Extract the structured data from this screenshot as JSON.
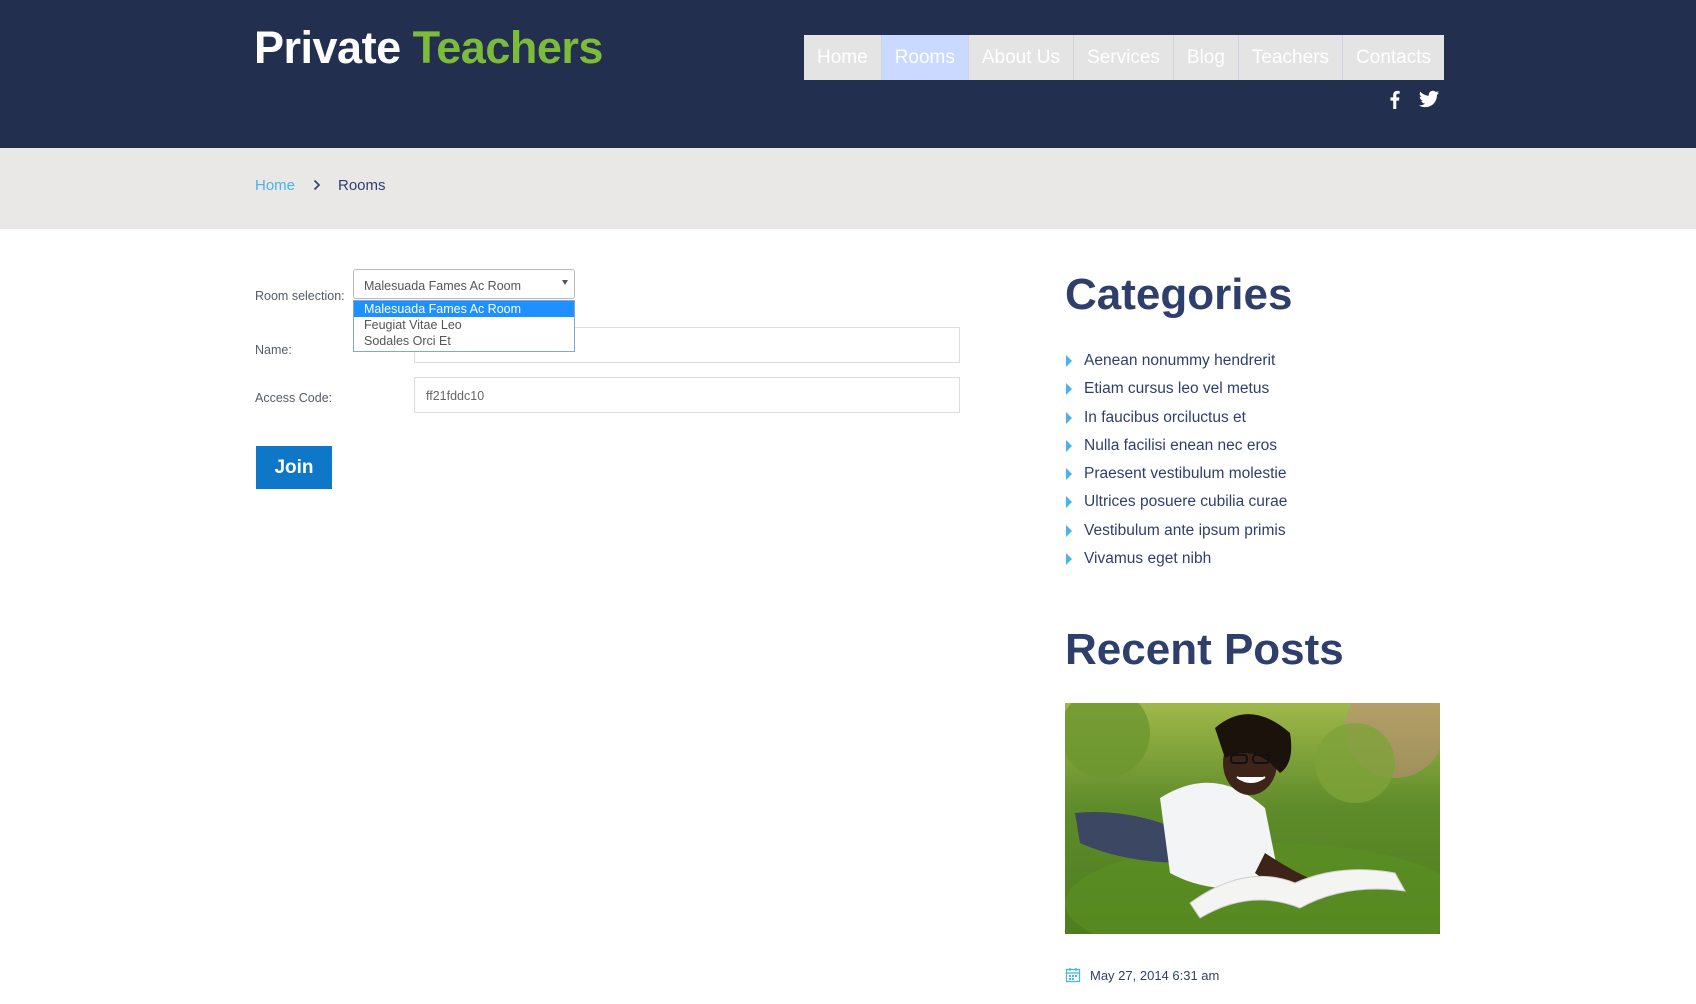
{
  "logo": {
    "word1": "Private",
    "word2": "Teachers"
  },
  "nav": {
    "items": [
      {
        "label": "Home"
      },
      {
        "label": "Rooms"
      },
      {
        "label": "About Us"
      },
      {
        "label": "Services"
      },
      {
        "label": "Blog"
      },
      {
        "label": "Teachers"
      },
      {
        "label": "Contacts"
      }
    ],
    "active": "Rooms"
  },
  "social": [
    "facebook-icon",
    "twitter-icon"
  ],
  "breadcrumb": {
    "home": "Home",
    "current": "Rooms"
  },
  "form": {
    "room_label": "Room selection:",
    "room_selected": "Malesuada Fames Ac Room",
    "room_options": [
      "Malesuada Fames Ac Room",
      "Feugiat Vitae Leo",
      "Sodales Orci Et"
    ],
    "name_label": "Name:",
    "name_value": "",
    "code_label": "Access Code:",
    "code_value": "ff21fddc10",
    "join_label": "Join"
  },
  "sidebar": {
    "categories_title": "Categories",
    "categories": [
      "Aenean nonummy hendrerit",
      "Etiam cursus leo vel metus",
      "In faucibus orciluctus et",
      "Nulla facilisi enean nec eros",
      "Praesent vestibulum molestie",
      "Ultrices posuere cubilia curae",
      "Vestibulum ante ipsum primis",
      "Vivamus eget nibh"
    ],
    "recent_title": "Recent Posts",
    "post_date": "May 27, 2014 6:31 am"
  },
  "colors": {
    "header_bg": "#232f4f",
    "brand_green": "#7dbb3b",
    "accent_blue": "#4ab3e8",
    "button_blue": "#0f77c7",
    "text_navy": "#2e3f6b"
  }
}
